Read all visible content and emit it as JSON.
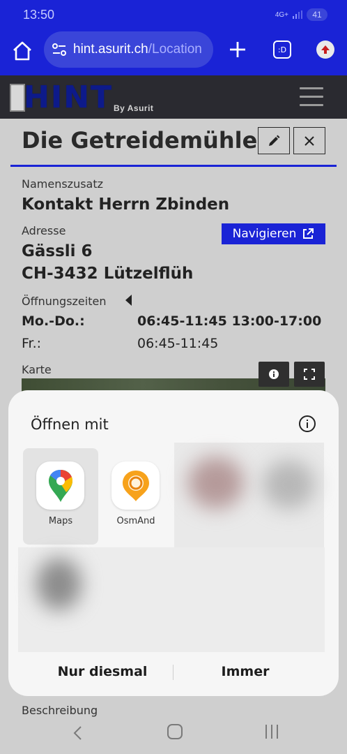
{
  "status_bar": {
    "time": "13:50",
    "signal_text": "4G+",
    "battery": "41"
  },
  "browser": {
    "url_host": "hint.asurit.ch",
    "url_path": "/Location",
    "tabs_icon_text": ":D"
  },
  "site": {
    "logo_text": "HINT",
    "logo_by": "By Asurit"
  },
  "location": {
    "title": "Die Getreidemühle",
    "namenszusatz_label": "Namenszusatz",
    "namenszusatz_value": "Kontakt Herrn Zbinden",
    "adresse_label": "Adresse",
    "navigate_label": "Navigieren",
    "address_line1": "Gässli 6",
    "address_line2": "CH-3432 Lützelflüh",
    "opening_label": "Öffnungszeiten",
    "hours": [
      {
        "day": "Mo.-Do.:",
        "time": "06:45-11:45 13:00-17:00"
      },
      {
        "day": "Fr.:",
        "time": "06:45-11:45"
      }
    ],
    "map_label": "Karte",
    "description_label": "Beschreibung"
  },
  "open_with_sheet": {
    "title": "Öffnen mit",
    "apps": [
      {
        "label": "Maps",
        "icon": "google-maps-icon"
      },
      {
        "label": "OsmAnd",
        "icon": "osmand-icon"
      }
    ],
    "once_label": "Nur diesmal",
    "always_label": "Immer"
  },
  "colors": {
    "browser_blue": "#1a23d6",
    "header_dark": "#2a2a30",
    "sheet_bg": "#f6f6f6"
  }
}
